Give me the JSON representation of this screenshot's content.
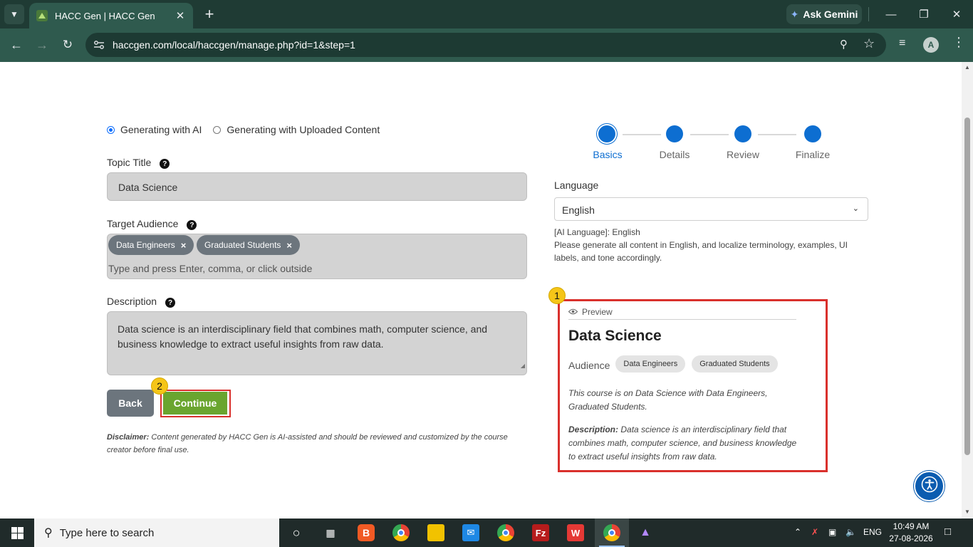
{
  "browser": {
    "tab_title": "HACC Gen | HACC Gen",
    "gemini_label": "Ask Gemini",
    "url": "haccgen.com/local/haccgen/manage.php?id=1&step=1",
    "profile_initial": "A"
  },
  "mode": {
    "ai_label": "Generating with AI",
    "upload_label": "Generating with Uploaded Content",
    "selected": "ai"
  },
  "form": {
    "topic_label": "Topic Title",
    "topic_value": "Data Science",
    "audience_label": "Target Audience",
    "audience_tags": [
      "Data Engineers",
      "Graduated Students"
    ],
    "audience_placeholder": "Type and press Enter, comma, or click outside",
    "description_label": "Description",
    "description_value": "Data science is an interdisciplinary field that combines math, computer science, and business knowledge to extract useful insights from raw data.",
    "back_label": "Back",
    "continue_label": "Continue",
    "disclaimer_bold": "Disclaimer:",
    "disclaimer_text": " Content generated by HACC Gen is AI-assisted and should be reviewed and customized by the course creator before final use."
  },
  "stepper": {
    "steps": [
      "Basics",
      "Details",
      "Review",
      "Finalize"
    ],
    "active_index": 0
  },
  "language": {
    "label": "Language",
    "selected": "English",
    "note_line1": "[AI Language]: English",
    "note_line2": "Please generate all content in English, and localize terminology, examples, UI labels, and tone accordingly."
  },
  "preview": {
    "header": "Preview",
    "title": "Data Science",
    "audience_label": "Audience",
    "audience_tags": [
      "Data Engineers",
      "Graduated Students"
    ],
    "summary": "This course is on Data Science with Data Engineers, Graduated Students.",
    "description_bold": "Description:",
    "description_text": " Data science is an interdisciplinary field that combines math, computer science, and business knowledge to extract useful insights from raw data."
  },
  "annotations": {
    "marker_1": "1",
    "marker_2": "2"
  },
  "taskbar": {
    "search_placeholder": "Type here to search",
    "language": "ENG",
    "time": "10:49 AM",
    "date": "27-08-2026"
  },
  "colors": {
    "chrome_dark": "#1f3b34",
    "chrome_toolbar": "#2f5a4e",
    "step_blue": "#0d6ed1",
    "continue_green": "#6aa52f",
    "highlight_red": "#d9302c",
    "marker_yellow": "#f5c518"
  }
}
